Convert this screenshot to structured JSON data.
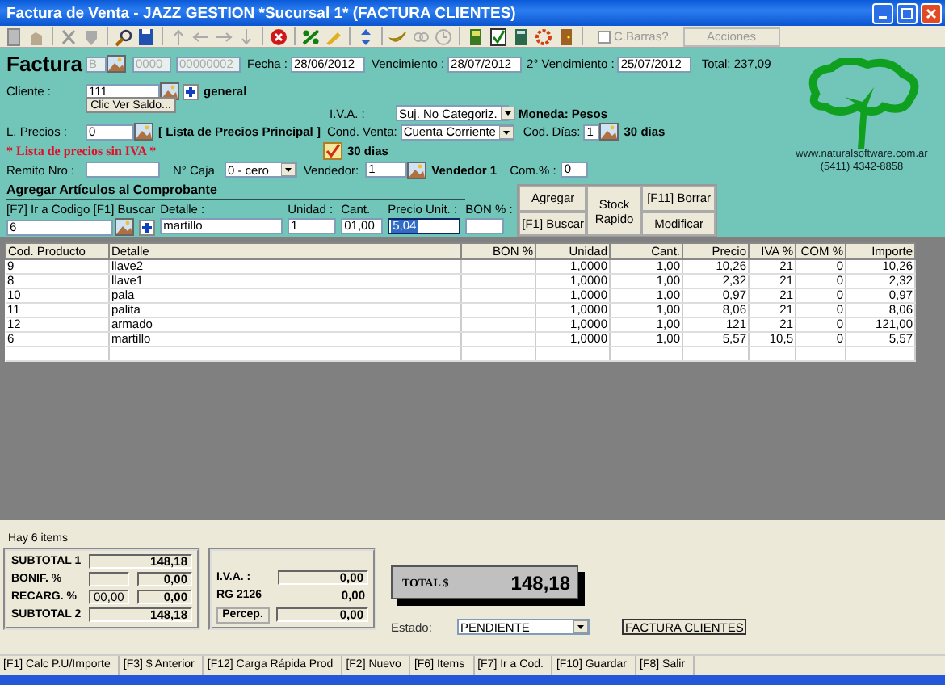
{
  "window": {
    "title": "Factura de Venta - JAZZ GESTION *Sucursal 1* (FACTURA CLIENTES)"
  },
  "toolbar": {
    "barcode_checkbox": {
      "label": "C.Barras?",
      "checked": false
    },
    "actions_button": {
      "label": "Acciones"
    }
  },
  "header": {
    "title": "Factura",
    "letter": "B",
    "point": "0000",
    "number": "00000002",
    "date": {
      "label": "Fecha :",
      "value": "28/06/2012"
    },
    "due": {
      "label": "Vencimiento :",
      "value": "28/07/2012"
    },
    "due2": {
      "label": "2° Vencimiento :",
      "value": "25/07/2012"
    },
    "total": "Total: 237,09"
  },
  "client": {
    "label": "Cliente :",
    "value": "111",
    "name": "general",
    "tooltip": "Clic Ver Saldo..."
  },
  "tax": {
    "label": "I.V.A. :",
    "value": "Suj. No Categoriz.",
    "currency": "Moneda: Pesos"
  },
  "price_list": {
    "label": "L. Precios :",
    "value": "0",
    "name": "[ Lista de Precios Principal ]",
    "warning": "* Lista de precios sin IVA *"
  },
  "sale_terms": {
    "label": "Cond. Venta:",
    "value": "Cuenta Corriente",
    "days_label": "Cod. Días:",
    "days_code": "1",
    "days_name": "30 dias"
  },
  "terms_flag": {
    "label": "30 dias",
    "checked": true
  },
  "receipt": {
    "label": "Remito Nro :"
  },
  "cash_box": {
    "label": "N° Caja",
    "value": "0 - cero"
  },
  "seller": {
    "label": "Vendedor:",
    "value": "1",
    "name": "Vendedor 1"
  },
  "commission": {
    "label": "Com.% :",
    "value": "0"
  },
  "company": {
    "website": "www.naturalsoftware.com.ar",
    "phone": "(5411) 4342-8858"
  },
  "add_item": {
    "title": "Agregar Artículos al Comprobante",
    "fields": [
      {
        "kind": "code",
        "label": "[F7] Ir a Codigo [F1] Buscar",
        "value": "6",
        "highlighted": false
      },
      {
        "kind": "detail",
        "label": "Detalle :",
        "value": "martillo",
        "highlighted": false
      },
      {
        "kind": "unit",
        "label": "Unidad :",
        "value": "1",
        "highlighted": false
      },
      {
        "kind": "qty",
        "label": "Cant.",
        "value": "01,00",
        "highlighted": false
      },
      {
        "kind": "price",
        "label": "Precio Unit. :",
        "value": "5,04",
        "highlighted": true
      },
      {
        "kind": "bonus",
        "label": "BON % :",
        "highlighted": false
      }
    ],
    "buttons": {
      "add": "Agregar",
      "search": "[F1] Buscar",
      "stock": "Stock Rapido",
      "delete": "[F11] Borrar",
      "modify": "Modificar"
    }
  },
  "table": {
    "columns": [
      "Cod. Producto",
      "Detalle",
      "BON %",
      "Unidad",
      "Cant.",
      "Precio",
      "IVA %",
      "COM %",
      "Importe"
    ],
    "rows": [
      {
        "code": "9",
        "detail": "llave2",
        "unit": "1,0000",
        "qty": "1,00",
        "price": "10,26",
        "iva": "21",
        "com": "0",
        "amount": "10,26"
      },
      {
        "code": "8",
        "detail": "llave1",
        "unit": "1,0000",
        "qty": "1,00",
        "price": "2,32",
        "iva": "21",
        "com": "0",
        "amount": "2,32"
      },
      {
        "code": "10",
        "detail": "pala",
        "unit": "1,0000",
        "qty": "1,00",
        "price": "0,97",
        "iva": "21",
        "com": "0",
        "amount": "0,97"
      },
      {
        "code": "11",
        "detail": "palita",
        "unit": "1,0000",
        "qty": "1,00",
        "price": "8,06",
        "iva": "21",
        "com": "0",
        "amount": "8,06"
      },
      {
        "code": "12",
        "detail": "armado",
        "unit": "1,0000",
        "qty": "1,00",
        "price": "121",
        "iva": "21",
        "com": "0",
        "amount": "121,00"
      },
      {
        "code": "6",
        "detail": "martillo",
        "unit": "1,0000",
        "qty": "1,00",
        "price": "5,57",
        "iva": "10,5",
        "com": "0",
        "amount": "5,57"
      }
    ]
  },
  "items_count": "Hay 6 items",
  "subtotals": {
    "subtotal1": {
      "label": "SUBTOTAL 1",
      "value": "148,18"
    },
    "discount": {
      "label": "BONIF. %",
      "value": "0,00"
    },
    "surcharge": {
      "label": "RECARG. %",
      "percent": "00,00",
      "value": "0,00"
    },
    "subtotal2": {
      "label": "SUBTOTAL 2",
      "value": "148,18"
    }
  },
  "taxes": {
    "iva": {
      "label": "I.V.A. :",
      "value": "0,00"
    },
    "rg": {
      "label": "RG 2126",
      "value": "0,00"
    },
    "percep": {
      "label": "Percep.",
      "value": "0,00"
    }
  },
  "total": {
    "label": "TOTAL $",
    "value": "148,18"
  },
  "status": {
    "label": "Estado:",
    "value": "PENDIENTE"
  },
  "doc_type": "FACTURA CLIENTES",
  "status_bar": [
    "[F1] Calc P.U/Importe",
    "[F3] $ Anterior",
    "[F12] Carga Rápida Prod",
    "[F2] Nuevo",
    "[F6] Items",
    "[F7] Ir a Cod.",
    "[F10] Guardar",
    "[F8] Salir"
  ]
}
